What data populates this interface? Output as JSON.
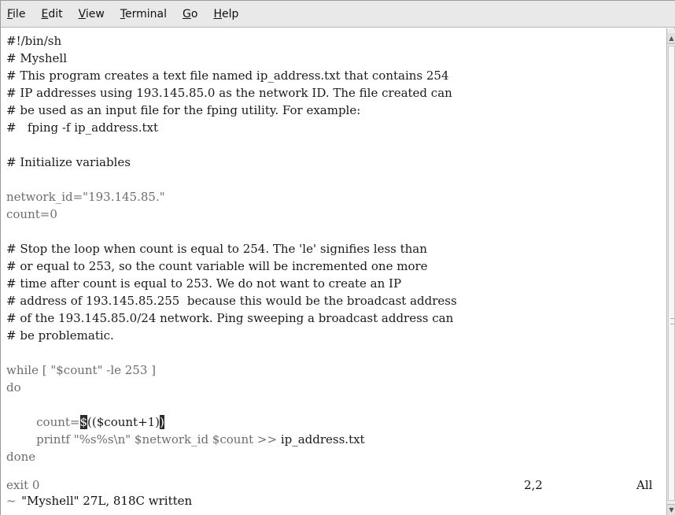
{
  "menu": {
    "file": {
      "mnemonic": "F",
      "rest": "ile"
    },
    "edit": {
      "mnemonic": "E",
      "rest": "dit"
    },
    "view": {
      "mnemonic": "V",
      "rest": "iew"
    },
    "terminal": {
      "mnemonic": "T",
      "rest": "erminal"
    },
    "go": {
      "mnemonic": "G",
      "rest": "o"
    },
    "help": {
      "mnemonic": "H",
      "rest": "elp"
    }
  },
  "editor": {
    "lines": {
      "l1": "#!/bin/sh",
      "l2": "# Myshell",
      "l3": "# This program creates a text file named ip_address.txt that contains 254",
      "l4": "# IP addresses using 193.145.85.0 as the network ID. The file created can",
      "l5": "# be used as an input file for the fping utility. For example:",
      "l6": "#   fping -f ip_address.txt",
      "l7": "",
      "l8": "# Initialize variables",
      "l9": "",
      "l10": "network_id=\"193.145.85.\"",
      "l11": "count=0",
      "l12": "",
      "l13": "# Stop the loop when count is equal to 254. The 'le' signifies less than",
      "l14": "# or equal to 253, so the count variable will be incremented one more",
      "l15": "# time after count is equal to 253. We do not want to create an IP",
      "l16": "# address of 193.145.85.255  because this would be the broadcast address",
      "l17": "# of the 193.145.85.0/24 network. Ping sweeping a broadcast address can",
      "l18": "# be problematic.",
      "l19": "",
      "l20": "while [ \"$count\" -le 253 ]",
      "l21": "do",
      "l22": "",
      "l23_pre": "        count=",
      "l23_cur1": "$",
      "l23_mid": "(($count+1)",
      "l23_cur2": ")",
      "l24_pre": "        printf \"%s%s\\n\" $network_id $count >> ",
      "l24_file": "ip_address.txt",
      "l25": "done",
      "l26": "",
      "l27": "exit 0",
      "l28": "~"
    }
  },
  "status": {
    "message": "\"Myshell\" 27L, 818C written",
    "position": "2,2",
    "scroll": "All"
  }
}
